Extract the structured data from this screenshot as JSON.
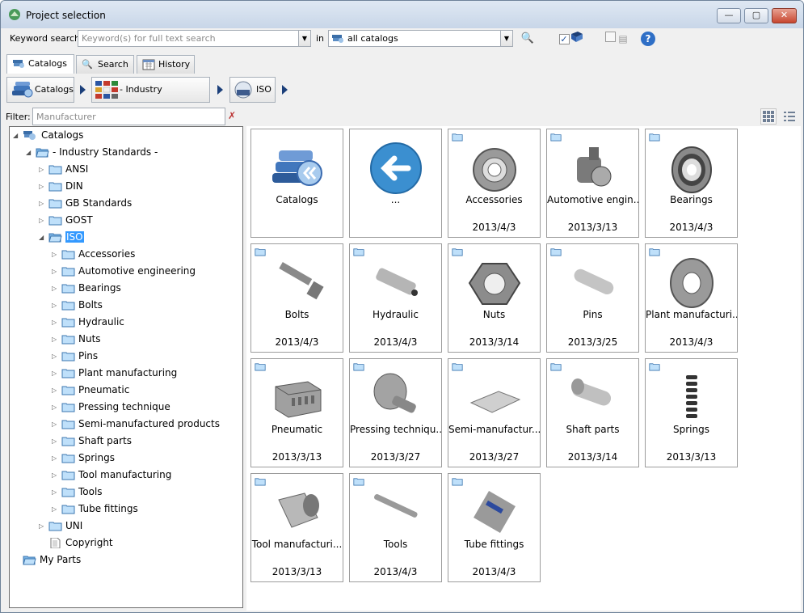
{
  "window": {
    "title": "Project selection",
    "btn_minimize": "—",
    "btn_maximize": "▢",
    "btn_close": "✕"
  },
  "toolbar": {
    "keyword_label": "Keyword search:",
    "keyword_placeholder": "Keyword(s) for full text search",
    "in_label": "in",
    "catalog_scope": "all catalogs"
  },
  "tabs": [
    {
      "label": "Catalogs"
    },
    {
      "label": "Search"
    },
    {
      "label": "History"
    }
  ],
  "breadcrumb": [
    {
      "label": "Catalogs"
    },
    {
      "label": "- Industry Standards -"
    },
    {
      "label": "ISO"
    }
  ],
  "filter": {
    "label": "Filter:",
    "placeholder": "Manufacturer"
  },
  "tree": {
    "root": "Catalogs",
    "industry": "- Industry Standards -",
    "level2": [
      "ANSI",
      "DIN",
      "GB Standards",
      "GOST",
      "ISO"
    ],
    "iso_children": [
      "Accessories",
      "Automotive engineering",
      "Bearings",
      "Bolts",
      "Hydraulic",
      "Nuts",
      "Pins",
      "Plant manufacturing",
      "Pneumatic",
      "Pressing technique",
      "Semi-manufactured products",
      "Shaft parts",
      "Springs",
      "Tool manufacturing",
      "Tools",
      "Tube fittings"
    ],
    "uni": "UNI",
    "copyright": "Copyright",
    "my_parts": "My Parts"
  },
  "cards": [
    {
      "name": "Catalogs",
      "date": "",
      "icon": "books-icon"
    },
    {
      "name": "...",
      "date": "",
      "icon": "back-arrow-icon"
    },
    {
      "name": "Accessories",
      "date": "2013/4/3",
      "icon": "accessories-part-icon"
    },
    {
      "name": "Automotive engin...",
      "date": "2013/3/13",
      "icon": "automotive-part-icon"
    },
    {
      "name": "Bearings",
      "date": "2013/4/3",
      "icon": "bearing-icon"
    },
    {
      "name": "Bolts",
      "date": "2013/4/3",
      "icon": "bolt-icon"
    },
    {
      "name": "Hydraulic",
      "date": "2013/4/3",
      "icon": "hydraulic-part-icon"
    },
    {
      "name": "Nuts",
      "date": "2013/3/14",
      "icon": "nut-icon"
    },
    {
      "name": "Pins",
      "date": "2013/3/25",
      "icon": "pin-icon"
    },
    {
      "name": "Plant manufacturi...",
      "date": "2013/4/3",
      "icon": "flange-icon"
    },
    {
      "name": "Pneumatic",
      "date": "2013/3/13",
      "icon": "pneumatic-block-icon"
    },
    {
      "name": "Pressing techniqu...",
      "date": "2013/3/27",
      "icon": "pressing-part-icon"
    },
    {
      "name": "Semi-manufactur...",
      "date": "2013/3/27",
      "icon": "plate-icon"
    },
    {
      "name": "Shaft parts",
      "date": "2013/3/14",
      "icon": "shaft-part-icon"
    },
    {
      "name": "Springs",
      "date": "2013/3/13",
      "icon": "spring-icon"
    },
    {
      "name": "Tool manufacturi...",
      "date": "2013/3/13",
      "icon": "bushing-icon"
    },
    {
      "name": "Tools",
      "date": "2013/4/3",
      "icon": "tool-icon"
    },
    {
      "name": "Tube fittings",
      "date": "2013/4/3",
      "icon": "tube-fitting-icon"
    }
  ]
}
